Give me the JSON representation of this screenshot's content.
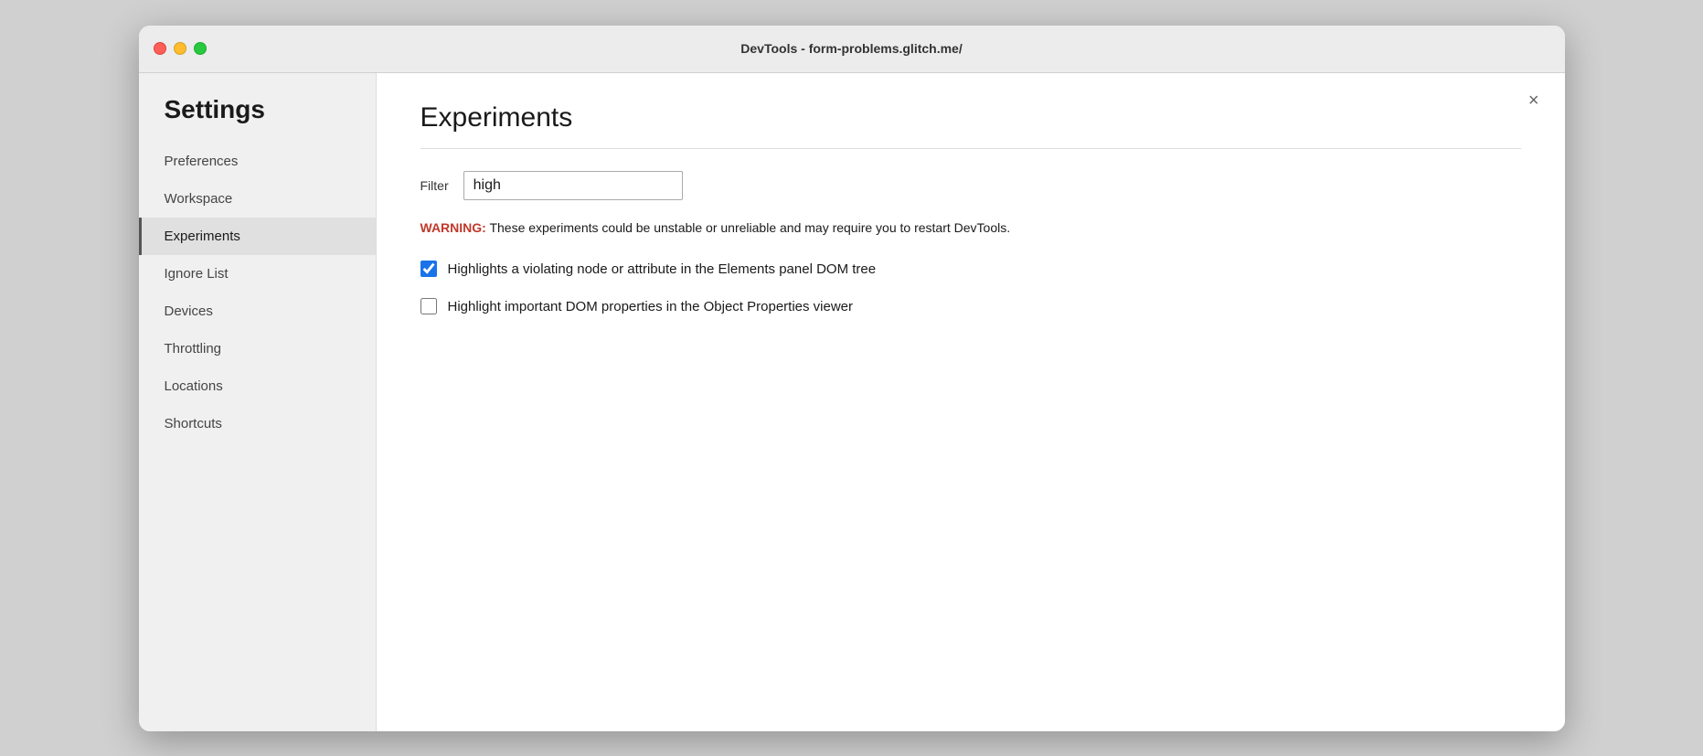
{
  "titlebar": {
    "title": "DevTools - form-problems.glitch.me/"
  },
  "sidebar": {
    "heading": "Settings",
    "items": [
      {
        "id": "preferences",
        "label": "Preferences",
        "active": false
      },
      {
        "id": "workspace",
        "label": "Workspace",
        "active": false
      },
      {
        "id": "experiments",
        "label": "Experiments",
        "active": true
      },
      {
        "id": "ignore-list",
        "label": "Ignore List",
        "active": false
      },
      {
        "id": "devices",
        "label": "Devices",
        "active": false
      },
      {
        "id": "throttling",
        "label": "Throttling",
        "active": false
      },
      {
        "id": "locations",
        "label": "Locations",
        "active": false
      },
      {
        "id": "shortcuts",
        "label": "Shortcuts",
        "active": false
      }
    ]
  },
  "main": {
    "title": "Experiments",
    "close_button": "×",
    "filter": {
      "label": "Filter",
      "value": "high",
      "placeholder": ""
    },
    "warning": {
      "prefix": "WARNING:",
      "message": " These experiments could be unstable or unreliable and may require you to restart DevTools."
    },
    "experiments": [
      {
        "id": "exp1",
        "label": "Highlights a violating node or attribute in the Elements panel DOM tree",
        "checked": true
      },
      {
        "id": "exp2",
        "label": "Highlight important DOM properties in the Object Properties viewer",
        "checked": false
      }
    ]
  }
}
